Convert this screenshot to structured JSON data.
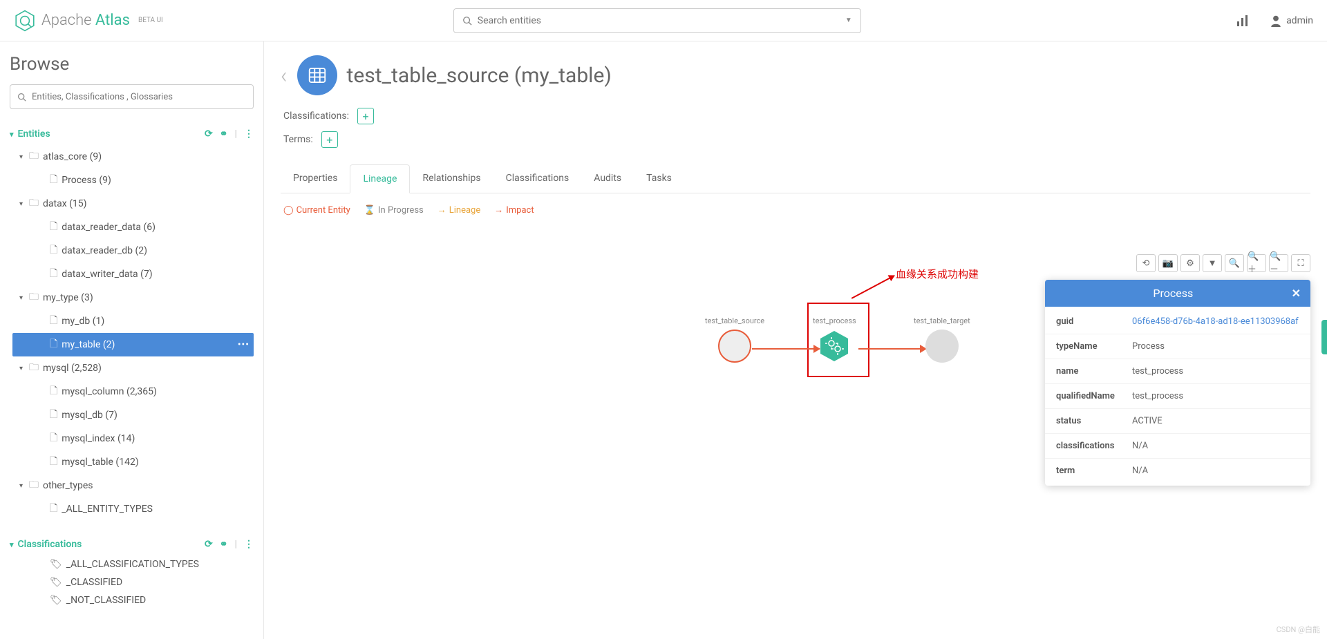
{
  "header": {
    "logo_prefix": "Apache ",
    "logo_brand": "Atlas",
    "logo_beta": "BETA UI",
    "search_placeholder": "Search entities",
    "user": "admin"
  },
  "sidebar": {
    "browse_title": "Browse",
    "filter_placeholder": "Entities, Classifications , Glossaries",
    "entities_label": "Entities",
    "classifications_label": "Classifications",
    "tree": [
      {
        "label": "atlas_core (9)",
        "expanded": true,
        "children": [
          {
            "label": "Process (9)"
          }
        ]
      },
      {
        "label": "datax (15)",
        "expanded": true,
        "children": [
          {
            "label": "datax_reader_data (6)"
          },
          {
            "label": "datax_reader_db (2)"
          },
          {
            "label": "datax_writer_data (7)"
          }
        ]
      },
      {
        "label": "my_type (3)",
        "expanded": true,
        "children": [
          {
            "label": "my_db (1)"
          },
          {
            "label": "my_table (2)",
            "selected": true
          }
        ]
      },
      {
        "label": "mysql (2,528)",
        "expanded": true,
        "children": [
          {
            "label": "mysql_column (2,365)"
          },
          {
            "label": "mysql_db (7)"
          },
          {
            "label": "mysql_index (14)"
          },
          {
            "label": "mysql_table (142)"
          }
        ]
      },
      {
        "label": "other_types",
        "expanded": true,
        "children": [
          {
            "label": "_ALL_ENTITY_TYPES"
          }
        ]
      }
    ],
    "classifications": [
      "_ALL_CLASSIFICATION_TYPES",
      "_CLASSIFIED",
      "_NOT_CLASSIFIED"
    ]
  },
  "entity": {
    "title": "test_table_source (my_table)",
    "classifications_label": "Classifications:",
    "terms_label": "Terms:",
    "tabs": [
      "Properties",
      "Lineage",
      "Relationships",
      "Classifications",
      "Audits",
      "Tasks"
    ],
    "active_tab": 1
  },
  "legend": {
    "current": "Current Entity",
    "progress": "In Progress",
    "lineage": "Lineage",
    "impact": "Impact"
  },
  "annotation": "血缘关系成功构建",
  "nodes": {
    "source": "test_table_source",
    "process": "test_process",
    "target": "test_table_target"
  },
  "info_panel": {
    "title": "Process",
    "rows": [
      {
        "key": "guid",
        "val": "06f6e458-d76b-4a18-ad18-ee11303968af",
        "link": true
      },
      {
        "key": "typeName",
        "val": "Process"
      },
      {
        "key": "name",
        "val": "test_process"
      },
      {
        "key": "qualifiedName",
        "val": "test_process"
      },
      {
        "key": "status",
        "val": "ACTIVE"
      },
      {
        "key": "classifications",
        "val": "N/A"
      },
      {
        "key": "term",
        "val": "N/A"
      }
    ]
  },
  "watermark": "CSDN @白能"
}
